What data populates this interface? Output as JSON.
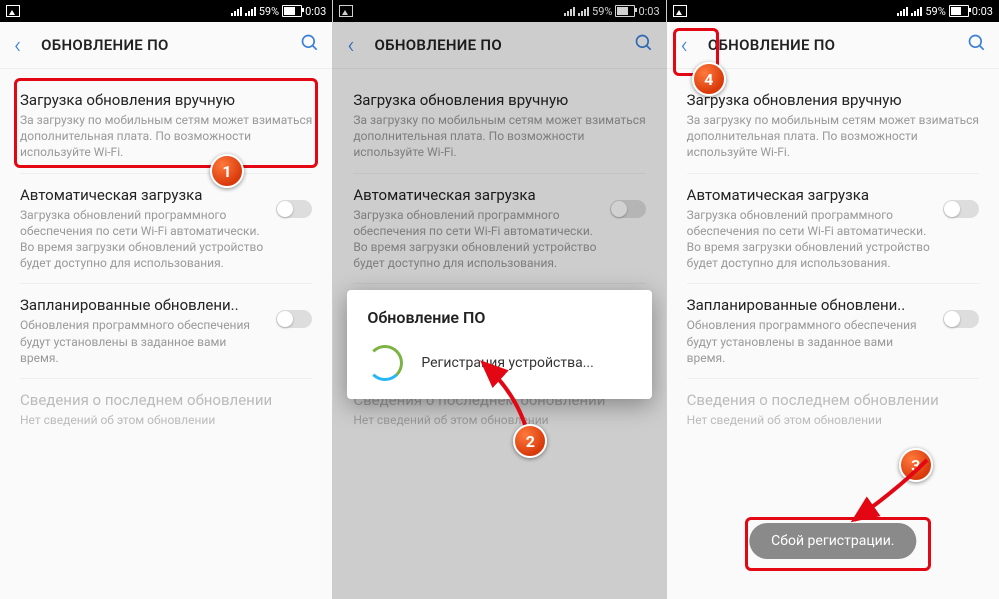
{
  "status": {
    "battery_pct": "59%",
    "time": "0:03"
  },
  "appbar": {
    "title": "ОБНОВЛЕНИЕ ПО"
  },
  "items": {
    "manual": {
      "title": "Загрузка обновления вручную",
      "sub": "За загрузку по мобильным сетям может взиматься дополнительная плата. По возможности используйте Wi-Fi."
    },
    "auto": {
      "title": "Автоматическая загрузка",
      "sub": "Загрузка обновлений программного обеспечения по сети Wi-Fi автоматически. Во время загрузки обновлений устройство будет доступно для использования."
    },
    "scheduled": {
      "title": "Запланированные обновлени..",
      "sub": "Обновления программного обеспечения будут установлены в заданное вами время."
    },
    "last": {
      "title": "Сведения о последнем обновлении",
      "sub": "Нет сведений об этом обновлении"
    }
  },
  "dialog": {
    "title": "Обновление ПО",
    "text": "Регистрация устройства..."
  },
  "toast": {
    "text": "Сбой регистрации."
  },
  "badges": {
    "b1": "1",
    "b2": "2",
    "b3": "3",
    "b4": "4"
  }
}
